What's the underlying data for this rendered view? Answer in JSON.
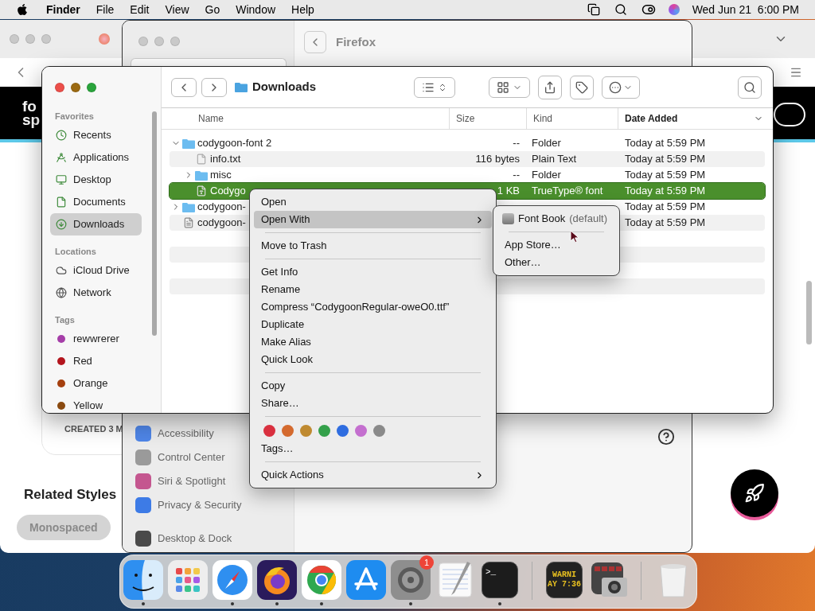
{
  "menu_bar": {
    "app": "Finder",
    "menus": [
      "File",
      "Edit",
      "View",
      "Go",
      "Window",
      "Help"
    ],
    "clock": "Wed Jun 21  6:00 PM"
  },
  "browser_window": {
    "logo_lines": [
      "fo",
      "sp"
    ],
    "card_caption": "CREATED 3 M",
    "section_title": "Related Styles",
    "chips": [
      {
        "label": "Monospaced"
      }
    ]
  },
  "settings_window": {
    "pane_title": "Firefox",
    "sidebar": [
      {
        "label": "Accessibility",
        "color": "#4f86e8"
      },
      {
        "label": "Control Center",
        "color": "#9a9a9a"
      },
      {
        "label": "Siri & Spotlight",
        "color": "#c4568f"
      },
      {
        "label": "Privacy & Security",
        "color": "#3d7be6"
      },
      {
        "label": "Desktop & Dock",
        "color": "#4a4a4a"
      }
    ]
  },
  "finder": {
    "path": "Downloads",
    "sidebar": [
      {
        "heading": "Favorites",
        "items": [
          {
            "label": "Recents",
            "kind": "recents",
            "selected": false
          },
          {
            "label": "Applications",
            "kind": "applications",
            "selected": false
          },
          {
            "label": "Desktop",
            "kind": "desktop",
            "selected": false
          },
          {
            "label": "Documents",
            "kind": "documents",
            "selected": false
          },
          {
            "label": "Downloads",
            "kind": "downloads",
            "selected": true
          }
        ]
      },
      {
        "heading": "Locations",
        "items": [
          {
            "label": "iCloud Drive",
            "kind": "icloud",
            "selected": false
          },
          {
            "label": "Network",
            "kind": "network",
            "selected": false
          }
        ]
      },
      {
        "heading": "Tags",
        "items": [
          {
            "label": "rewwrerer",
            "kind": "tag",
            "color": "#a53ea8",
            "selected": false
          },
          {
            "label": "Red",
            "kind": "tag",
            "color": "#b3151d",
            "selected": false
          },
          {
            "label": "Orange",
            "kind": "tag",
            "color": "#a5400f",
            "selected": false
          },
          {
            "label": "Yellow",
            "kind": "tag",
            "color": "#8a4a10",
            "selected": false
          }
        ]
      }
    ],
    "columns": [
      {
        "label": "Name",
        "sorted": false
      },
      {
        "label": "Size",
        "sorted": false
      },
      {
        "label": "Kind",
        "sorted": false
      },
      {
        "label": "Date Added",
        "sorted": true
      }
    ],
    "rows": [
      {
        "name": "codygoon-font 2",
        "size": "--",
        "kind_label": "Folder",
        "date": "Today at 5:59 PM",
        "kind": "folder",
        "expanded": true,
        "selected": false,
        "children": [
          {
            "name": "info.txt",
            "size": "116 bytes",
            "kind_label": "Plain Text",
            "date": "Today at 5:59 PM",
            "kind": "text",
            "selected": false
          },
          {
            "name": "misc",
            "size": "--",
            "kind_label": "Folder",
            "date": "Today at 5:59 PM",
            "kind": "folder",
            "expanded": false,
            "selected": false
          },
          {
            "name": "Codygo",
            "size": "1 KB",
            "kind_label": "TrueType® font",
            "date": "Today at 5:59 PM",
            "kind": "font",
            "selected": true
          }
        ]
      },
      {
        "name": "codygoon-",
        "date": "Today at 5:59 PM",
        "kind": "folder",
        "expanded": false,
        "selected": false
      },
      {
        "name": "codygoon-",
        "date": "Today at 5:59 PM",
        "kind": "doc",
        "selected": false
      }
    ]
  },
  "context_menu": {
    "items": [
      {
        "kind": "item",
        "label": "Open",
        "has_submenu": false,
        "selected": false
      },
      {
        "kind": "item",
        "label": "Open With",
        "has_submenu": true,
        "selected": true
      },
      {
        "kind": "separator"
      },
      {
        "kind": "item",
        "label": "Move to Trash",
        "has_submenu": false,
        "selected": false
      },
      {
        "kind": "separator"
      },
      {
        "kind": "item",
        "label": "Get Info",
        "has_submenu": false,
        "selected": false
      },
      {
        "kind": "item",
        "label": "Rename",
        "has_submenu": false,
        "selected": false
      },
      {
        "kind": "item",
        "label": "Compress “CodygoonRegular-oweO0.ttf”",
        "has_submenu": false,
        "selected": false
      },
      {
        "kind": "item",
        "label": "Duplicate",
        "has_submenu": false,
        "selected": false
      },
      {
        "kind": "item",
        "label": "Make Alias",
        "has_submenu": false,
        "selected": false
      },
      {
        "kind": "item",
        "label": "Quick Look",
        "has_submenu": false,
        "selected": false
      },
      {
        "kind": "separator"
      },
      {
        "kind": "item",
        "label": "Copy",
        "has_submenu": false,
        "selected": false
      },
      {
        "kind": "item",
        "label": "Share…",
        "has_submenu": false,
        "selected": false
      },
      {
        "kind": "separator"
      },
      {
        "kind": "tags",
        "tags": [
          {
            "color": "#d9303f"
          },
          {
            "color": "#d46a2e"
          },
          {
            "color": "#bf8a30"
          },
          {
            "color": "#34a04a"
          },
          {
            "color": "#2f6de0"
          },
          {
            "color": "#c46fcf"
          },
          {
            "color": "#8a8a8a"
          }
        ]
      },
      {
        "kind": "item",
        "label": "Tags…",
        "has_submenu": false,
        "selected": false
      },
      {
        "kind": "separator"
      },
      {
        "kind": "item",
        "label": "Quick Actions",
        "has_submenu": true,
        "selected": false
      }
    ]
  },
  "submenu": {
    "items": [
      {
        "kind": "app",
        "label": "Font Book",
        "note": "(default)"
      },
      {
        "kind": "separator"
      },
      {
        "kind": "item",
        "label": "App Store…"
      },
      {
        "kind": "item",
        "label": "Other…"
      }
    ]
  },
  "dock": {
    "items": [
      {
        "kind": "finder",
        "running": true
      },
      {
        "kind": "launchpad"
      },
      {
        "kind": "safari",
        "running": true
      },
      {
        "kind": "firefox",
        "running": true
      },
      {
        "kind": "chrome",
        "running": true
      },
      {
        "kind": "appstore"
      },
      {
        "kind": "settings",
        "running": true,
        "badge": "1"
      },
      {
        "kind": "textedit"
      },
      {
        "kind": "terminal",
        "running": true,
        "glyph": ">_"
      },
      {
        "kind": "divider"
      },
      {
        "kind": "console",
        "lines": [
          "WARNI",
          "AY 7:36"
        ]
      },
      {
        "kind": "screenshot"
      },
      {
        "kind": "divider"
      },
      {
        "kind": "trash"
      }
    ]
  }
}
